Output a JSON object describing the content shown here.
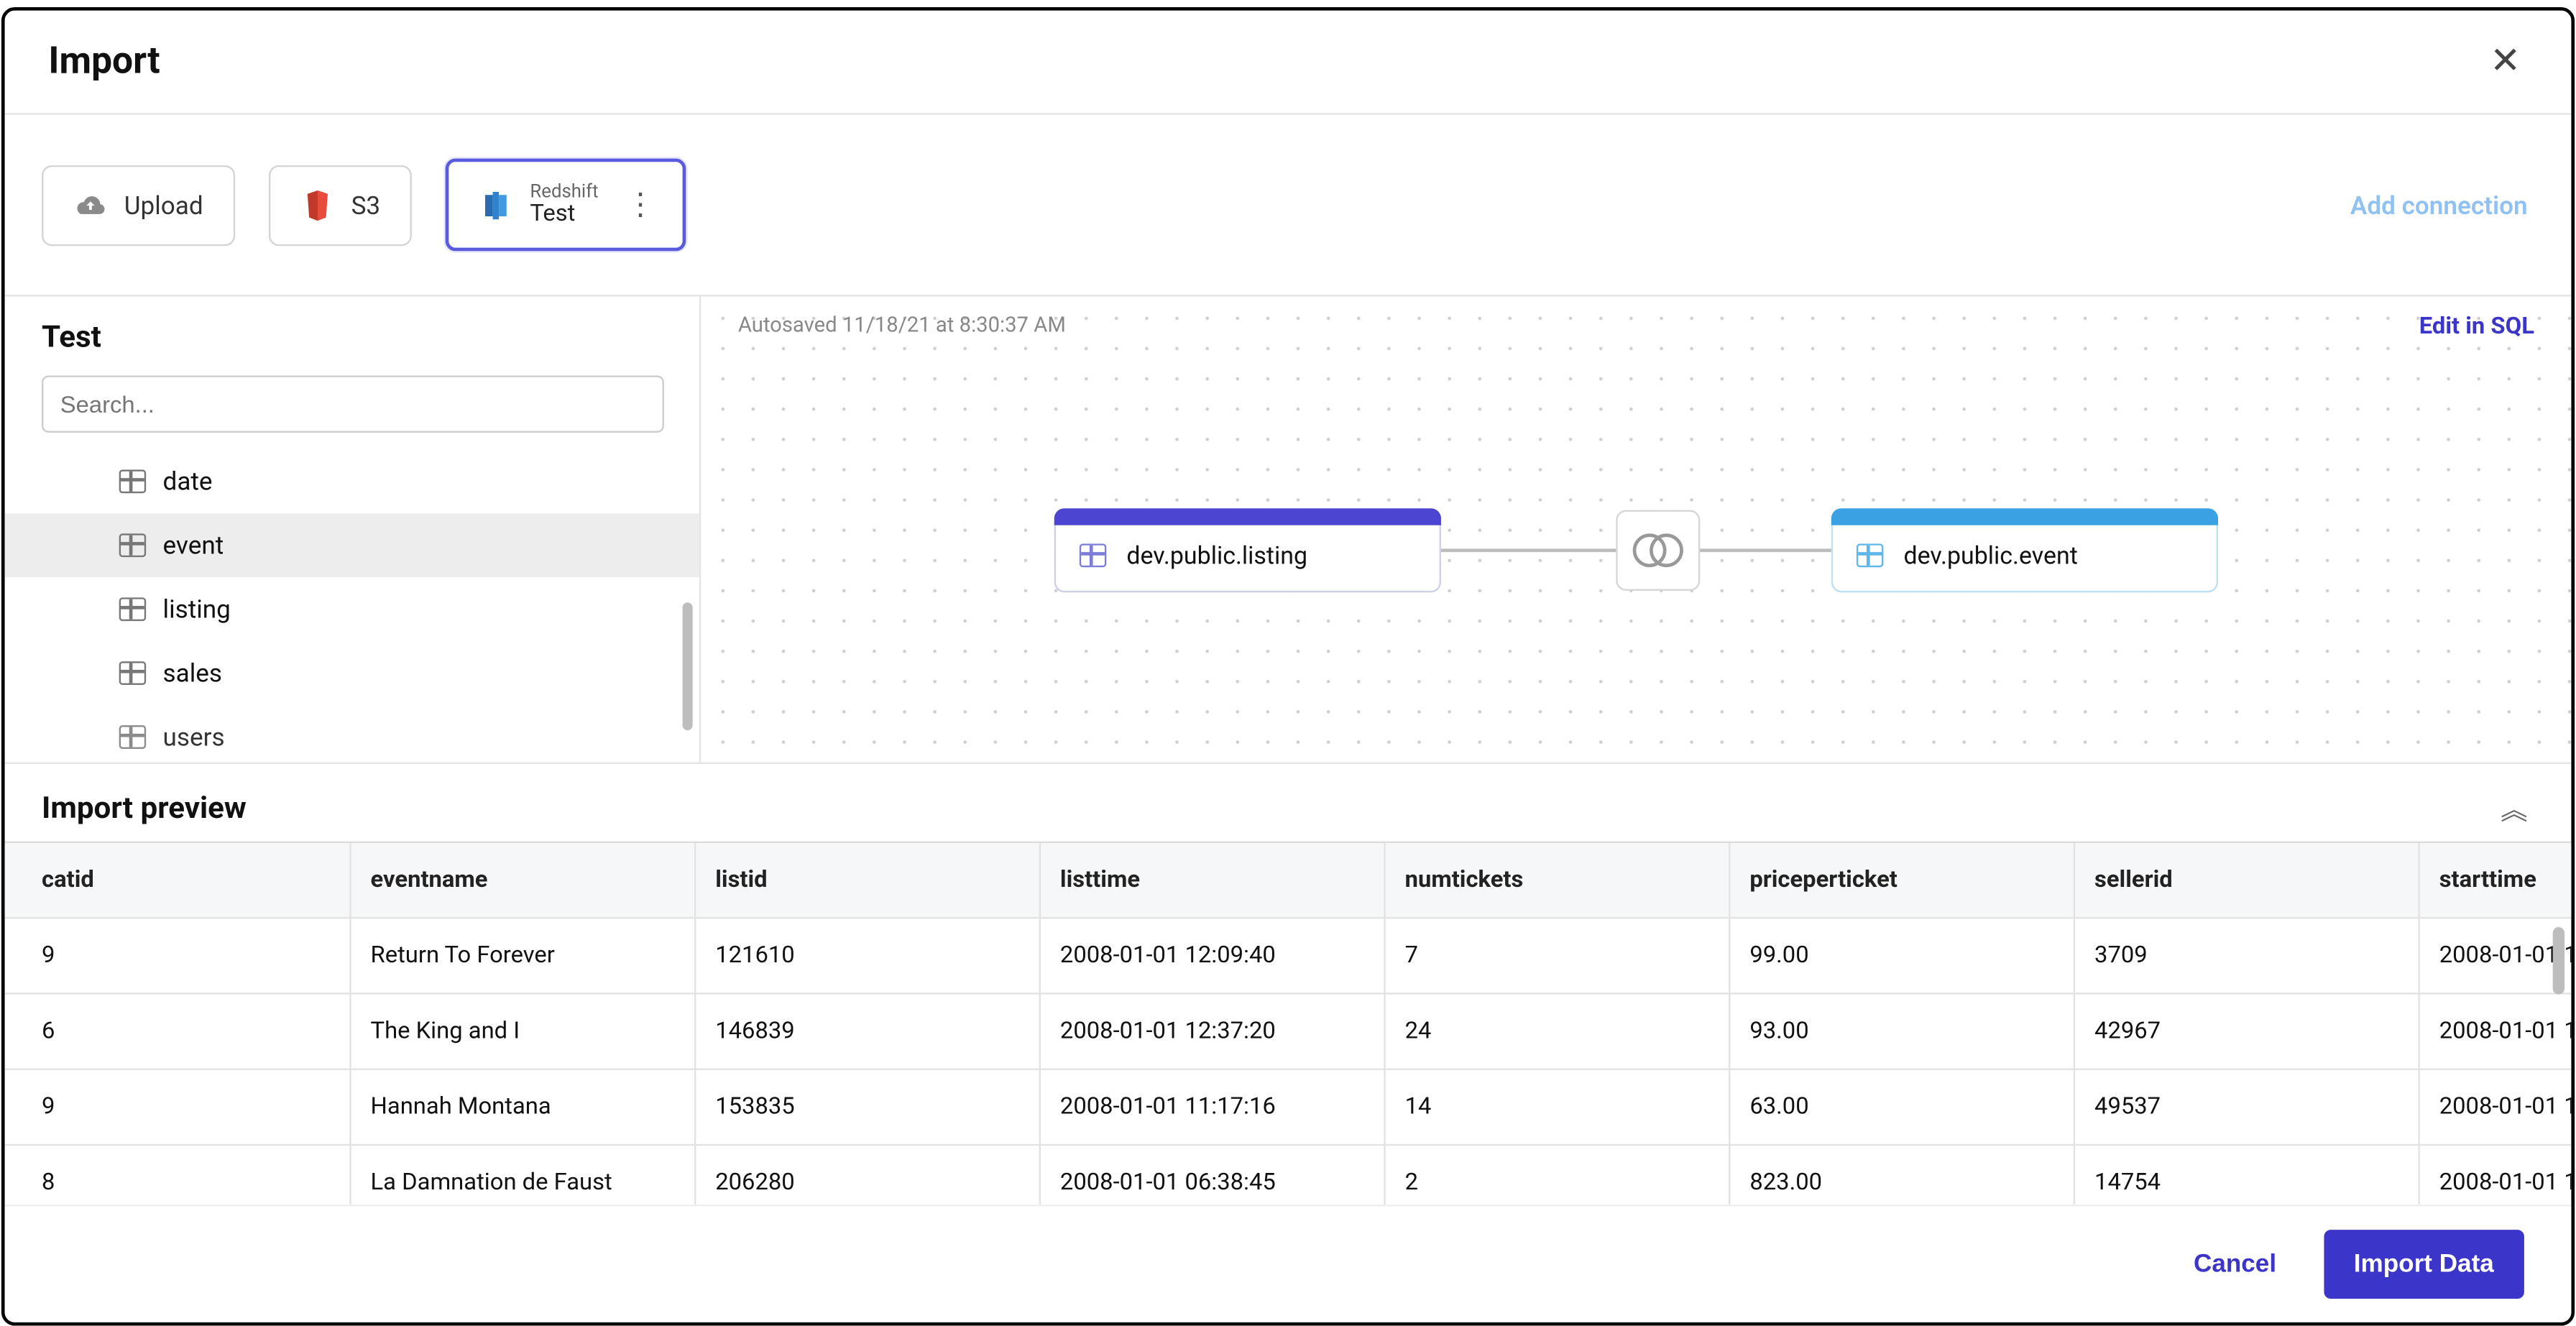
{
  "header": {
    "title": "Import"
  },
  "toolbar": {
    "upload_label": "Upload",
    "s3_label": "S3",
    "redshift_small": "Redshift",
    "redshift_name": "Test",
    "add_connection": "Add connection"
  },
  "sidebar": {
    "title": "Test",
    "search_placeholder": "Search...",
    "tables": [
      {
        "name": "date",
        "selected": false
      },
      {
        "name": "event",
        "selected": true
      },
      {
        "name": "listing",
        "selected": false
      },
      {
        "name": "sales",
        "selected": false
      },
      {
        "name": "users",
        "selected": false
      }
    ]
  },
  "canvas": {
    "autosaved": "Autosaved 11/18/21 at 8:30:37 AM",
    "edit_sql": "Edit in SQL",
    "node_left": "dev.public.listing",
    "node_right": "dev.public.event"
  },
  "preview": {
    "title": "Import preview",
    "columns": [
      "catid",
      "eventname",
      "listid",
      "listtime",
      "numtickets",
      "priceperticket",
      "sellerid",
      "starttime"
    ],
    "rows": [
      [
        "9",
        "Return To Forever",
        "121610",
        "2008-01-01 12:09:40",
        "7",
        "99.00",
        "3709",
        "2008-01-01 1"
      ],
      [
        "6",
        "The King and I",
        "146839",
        "2008-01-01 12:37:20",
        "24",
        "93.00",
        "42967",
        "2008-01-01 1"
      ],
      [
        "9",
        "Hannah Montana",
        "153835",
        "2008-01-01 11:17:16",
        "14",
        "63.00",
        "49537",
        "2008-01-01 1"
      ],
      [
        "8",
        "La Damnation de Faust",
        "206280",
        "2008-01-01 06:38:45",
        "2",
        "823.00",
        "14754",
        "2008-01-01 1"
      ]
    ]
  },
  "footer": {
    "cancel": "Cancel",
    "import": "Import Data"
  }
}
